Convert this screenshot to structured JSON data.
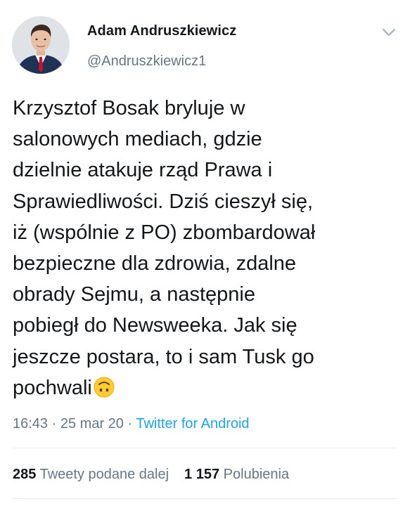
{
  "author": {
    "name": "Adam Andruszkiewicz",
    "handle": "@Andruszkiewicz1"
  },
  "tweet": {
    "lines": [
      "Krzysztof Bosak bryluje w",
      "salonowych mediach, gdzie",
      "dzielnie atakuje rząd Prawa i",
      "Sprawiedliwości. Dziś cieszył się,",
      "iż (wspólnie z PO) zbombardował",
      "bezpieczne dla zdrowia, zdalne",
      "obrady Sejmu, a następnie",
      "pobiegł do Newsweeka. Jak się",
      "jeszcze postara, to i sam Tusk go",
      "pochwali"
    ],
    "emoji": "upside-down-face-icon"
  },
  "meta": {
    "time": "16:43",
    "separator": "·",
    "date": "25 mar 20",
    "source": "Twitter for Android"
  },
  "stats": {
    "retweets_count": "285",
    "retweets_label": "Tweety podane dalej",
    "likes_count": "1 157",
    "likes_label": "Polubienia"
  },
  "colors": {
    "text": "#14171a",
    "secondary": "#657786",
    "link": "#1da1f2",
    "divider": "#e6ecf0"
  }
}
